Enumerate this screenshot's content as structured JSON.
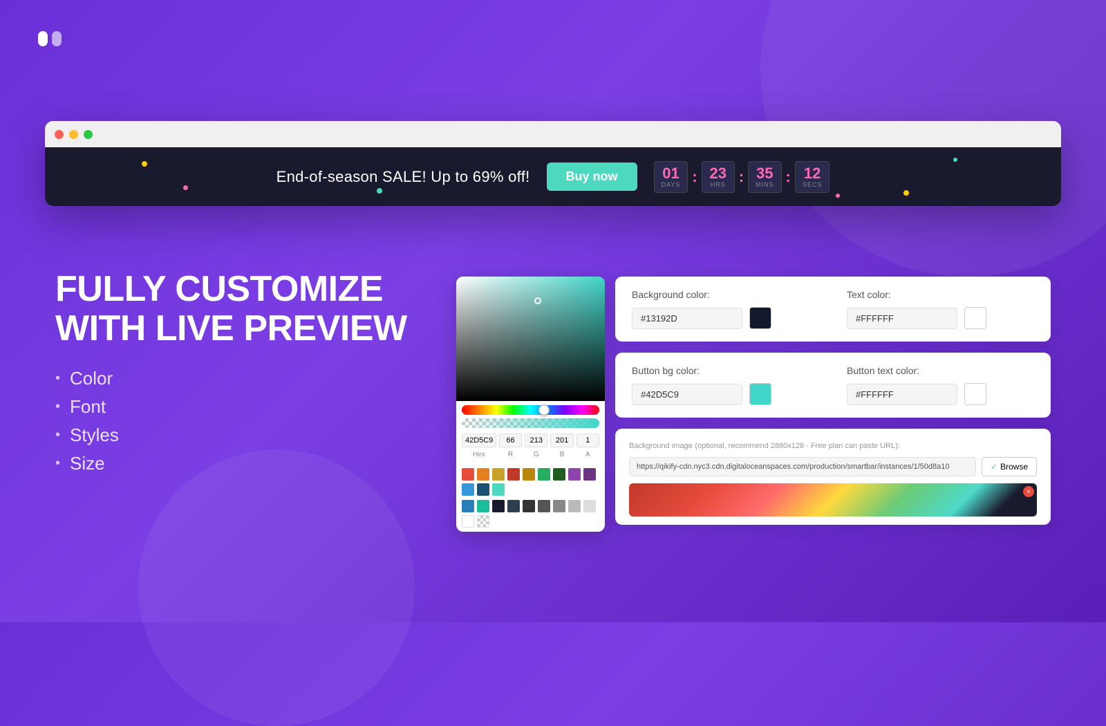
{
  "logo": {
    "alt": "App logo"
  },
  "browser": {
    "dots": [
      "red",
      "yellow",
      "green"
    ]
  },
  "banner": {
    "text": "End-of-season SALE! Up to 69% off!",
    "button_label": "Buy now",
    "countdown": {
      "days_val": "01",
      "days_label": "DAYS",
      "hrs_val": "23",
      "hrs_label": "HRS",
      "mins_val": "35",
      "mins_label": "MINS",
      "secs_val": "12",
      "secs_label": "SECS"
    }
  },
  "hero": {
    "title_line1": "FULLY CUSTOMIZE",
    "title_line2": "WITH LIVE PREVIEW",
    "features": [
      "Color",
      "Font",
      "Styles",
      "Size"
    ]
  },
  "color_picker": {
    "hex_val": "42D5C9",
    "r_val": "66",
    "g_val": "213",
    "b_val": "201",
    "a_val": "1",
    "hex_label": "Hex",
    "r_label": "R",
    "g_label": "G",
    "b_label": "B",
    "a_label": "A"
  },
  "bg_color_panel": {
    "label": "Background color:",
    "hex_val": "#13192D",
    "swatch_color": "#13192D",
    "text_color_label": "Text color:",
    "text_hex_val": "#FFFFFF",
    "text_swatch_color": "#FFFFFF"
  },
  "button_color_panel": {
    "label": "Button bg color:",
    "hex_val": "#42D5C9",
    "swatch_color": "#42D5C9",
    "text_color_label": "Button text color:",
    "text_hex_val": "#FFFFFF",
    "text_swatch_color": "#FFFFFF"
  },
  "image_panel": {
    "label": "Background image",
    "sublabel": "(optional, recommend 2880x128 - Free plan can paste URL):",
    "url_val": "https://qikify-cdn.nyc3.cdn.digitaloceanspaces.com/production/smartbar/instances/1/50d8a10",
    "browse_label": "Browse"
  }
}
